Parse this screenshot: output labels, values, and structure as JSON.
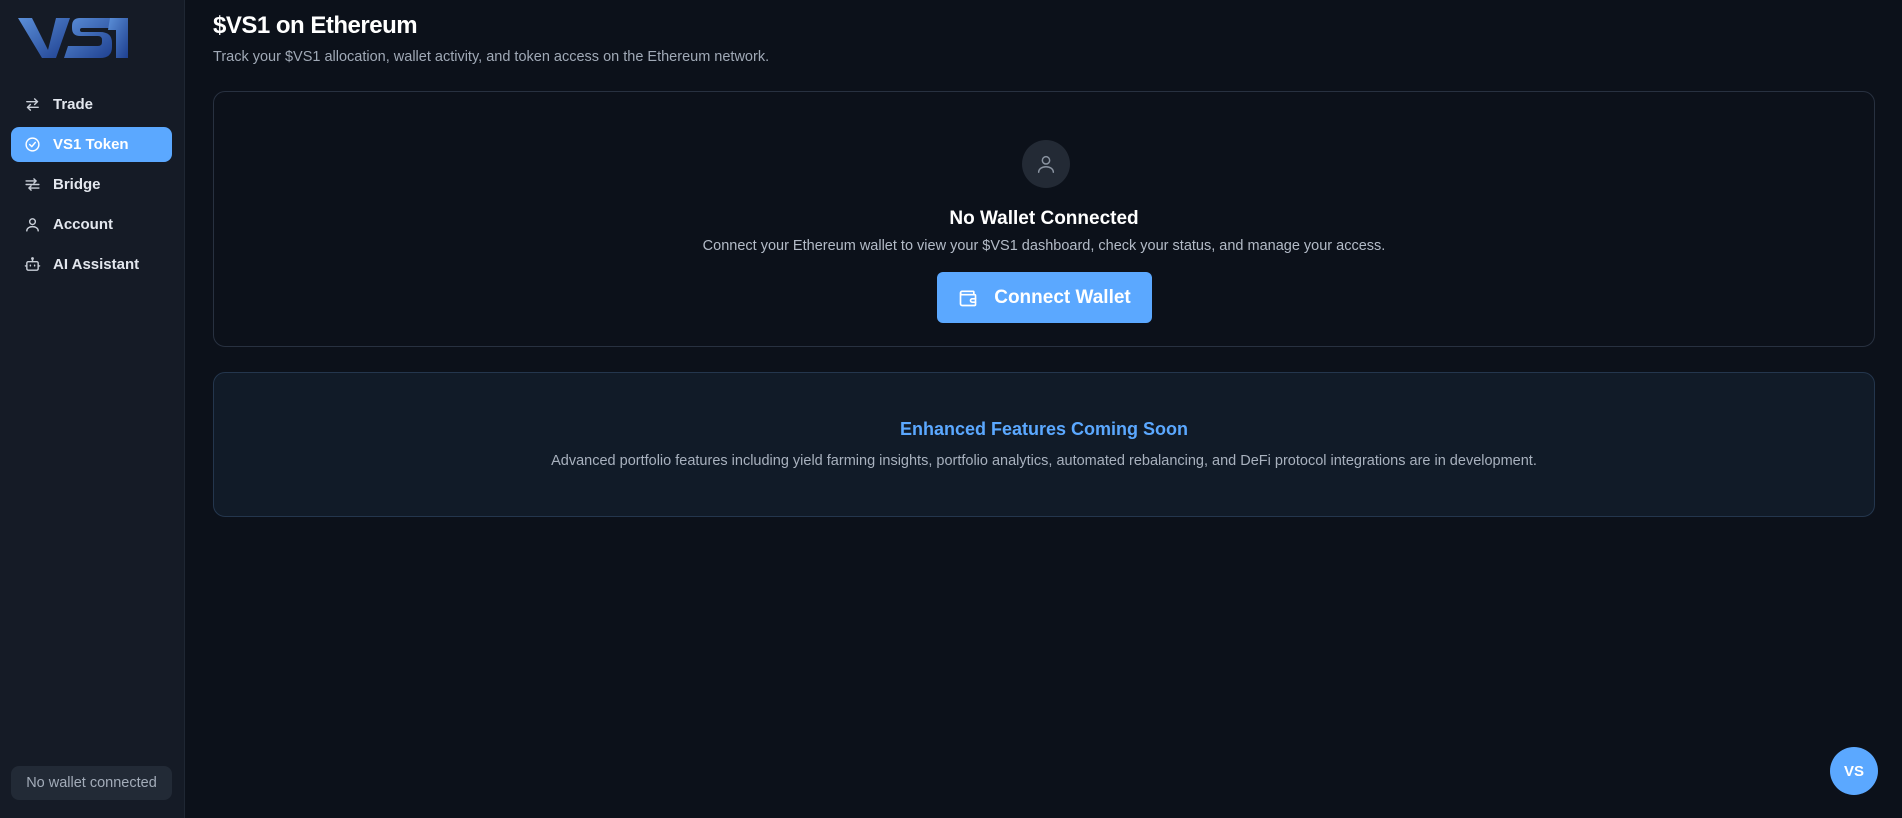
{
  "brand": {
    "logo_text": "VS1",
    "logo_icon": "vs1-logo"
  },
  "sidebar": {
    "items": [
      {
        "label": "Trade",
        "icon": "swap-arrows-icon",
        "active": false
      },
      {
        "label": "VS1 Token",
        "icon": "check-circle-icon",
        "active": true
      },
      {
        "label": "Bridge",
        "icon": "bridge-arrows-icon",
        "active": false
      },
      {
        "label": "Account",
        "icon": "user-icon",
        "active": false
      },
      {
        "label": "AI Assistant",
        "icon": "robot-icon",
        "active": false
      }
    ],
    "wallet_status": "No wallet connected"
  },
  "header": {
    "title": "$VS1 on Ethereum",
    "subtitle": "Track your $VS1 allocation, wallet activity, and token access on the Ethereum network."
  },
  "wallet_card": {
    "icon": "user-icon",
    "title": "No Wallet Connected",
    "description": "Connect your Ethereum wallet to view your $VS1 dashboard, check your status, and manage your access.",
    "button_label": "Connect Wallet",
    "button_icon": "wallet-icon"
  },
  "features_card": {
    "title": "Enhanced Features Coming Soon",
    "description": "Advanced portfolio features including yield farming insights, portfolio analytics, automated rebalancing, and DeFi protocol integrations are in development."
  },
  "fab": {
    "label": "VS"
  },
  "colors": {
    "accent": "#5ba8ff",
    "background": "#0c111a",
    "sidebar": "#151b26"
  }
}
